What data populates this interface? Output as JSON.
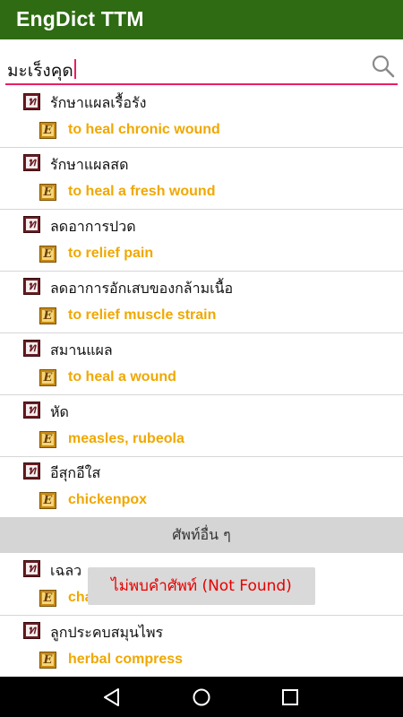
{
  "app": {
    "title": "EngDict TTM"
  },
  "search": {
    "value": "มะเร็งคุด"
  },
  "results": [
    {
      "thai": "รักษาแผลเรื้อรัง",
      "english": "to heal chronic wound"
    },
    {
      "thai": "รักษาแผลสด",
      "english": "to heal a fresh wound"
    },
    {
      "thai": "ลดอาการปวด",
      "english": "to relief pain"
    },
    {
      "thai": "ลดอาการอักเสบของกล้ามเนื้อ",
      "english": "to relief muscle strain"
    },
    {
      "thai": "สมานแผล",
      "english": "to heal a wound"
    },
    {
      "thai": "หัด",
      "english": "measles, rubeola"
    },
    {
      "thai": "อีสุกอีใส",
      "english": "chickenpox"
    }
  ],
  "other_section": {
    "title": "ศัพท์อื่น ๆ"
  },
  "other_results": [
    {
      "thai": "เฉลว",
      "english": "cha"
    },
    {
      "thai": "ลูกประคบสมุนไพร",
      "english": "herbal compress"
    }
  ],
  "badges": {
    "thai_letter": "ท",
    "english_letter": "E"
  },
  "toast": {
    "message": "ไม่พบคำศัพท์ (Not Found)"
  },
  "icons": {
    "search": "search-icon",
    "back": "back-icon",
    "home": "home-icon",
    "recents": "recents-icon"
  },
  "colors": {
    "appbar": "#2e6b12",
    "accent": "#e91e63",
    "english_text": "#f0a800",
    "toast_text": "#e60000"
  }
}
